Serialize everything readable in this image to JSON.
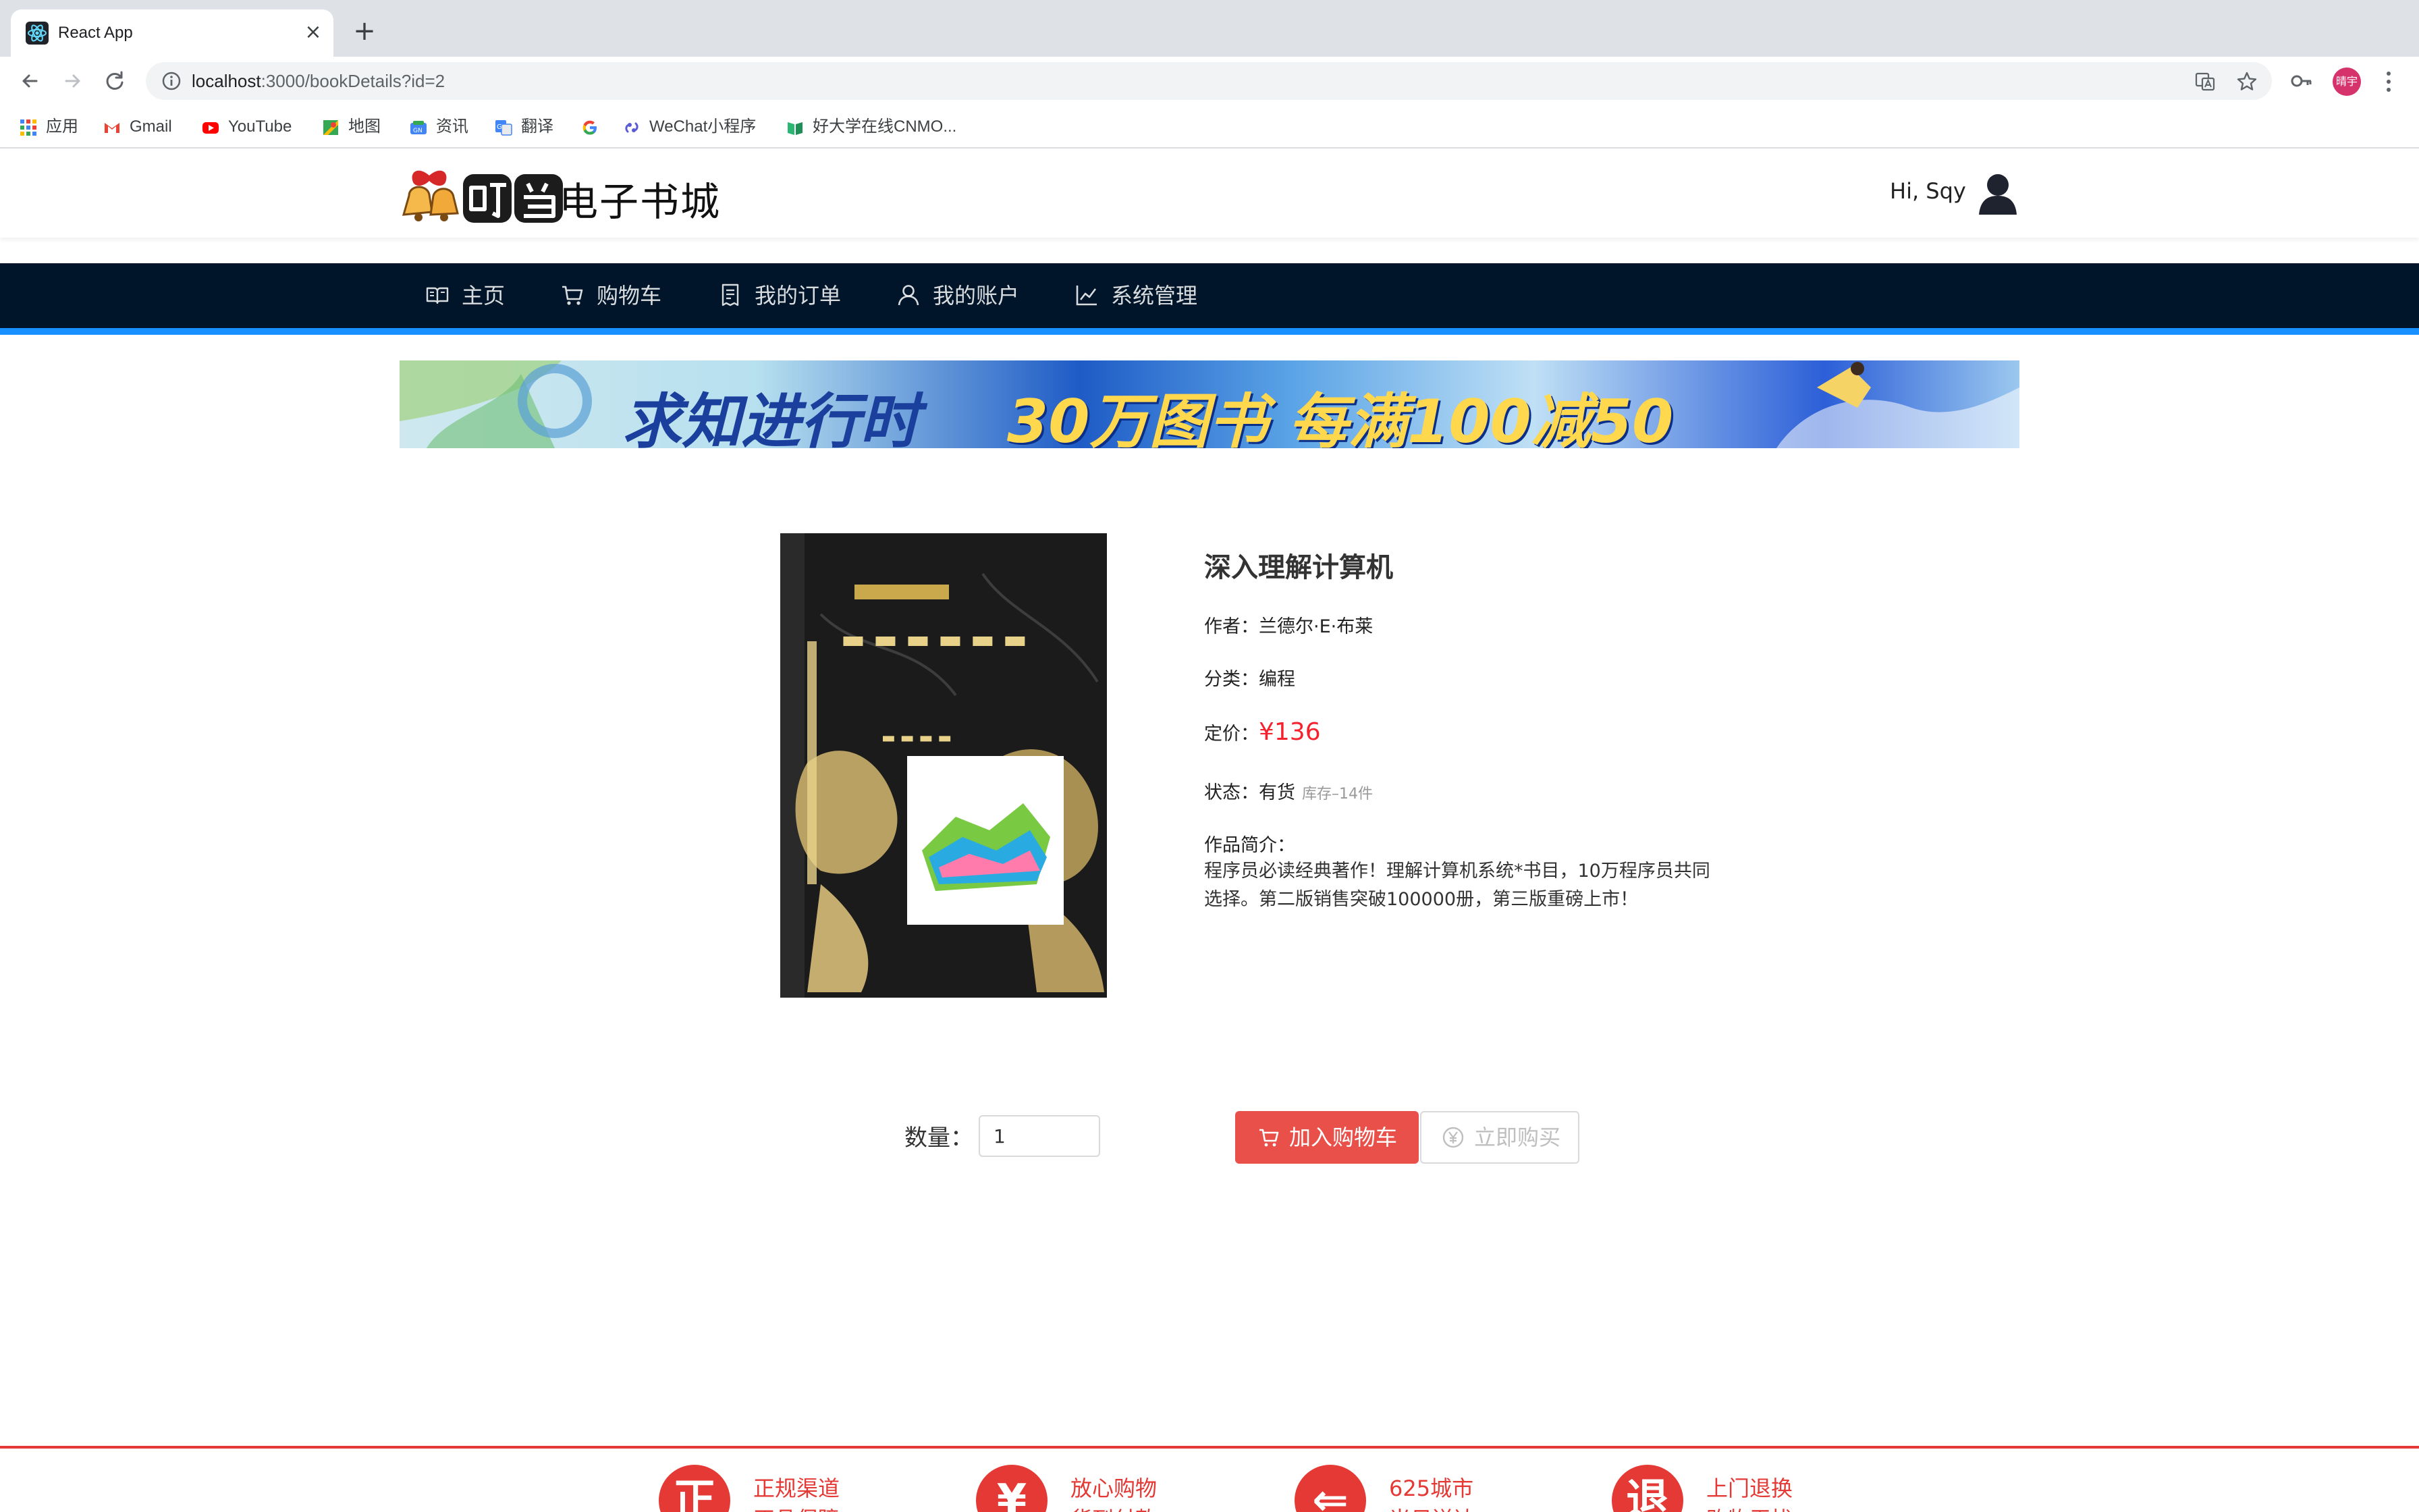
{
  "browser": {
    "tab_title": "React App",
    "tab_close": "×",
    "new_tab": "+",
    "url_host": "localhost",
    "url_path": ":3000/bookDetails?id=2",
    "profile_initials": "晴宇"
  },
  "bookmarks": [
    {
      "label": "应用",
      "icon": "apps-grid-icon"
    },
    {
      "label": "Gmail",
      "icon": "gmail-icon"
    },
    {
      "label": "YouTube",
      "icon": "youtube-icon"
    },
    {
      "label": "地图",
      "icon": "maps-icon"
    },
    {
      "label": "资讯",
      "icon": "news-icon"
    },
    {
      "label": "翻译",
      "icon": "translate-icon"
    },
    {
      "label": "",
      "icon": "google-icon"
    },
    {
      "label": "WeChat小程序",
      "icon": "wechat-link-icon"
    },
    {
      "label": "好大学在线CNMO...",
      "icon": "book-icon"
    }
  ],
  "header": {
    "logo_text": "电子书城",
    "greeting": "Hi, Sqy"
  },
  "nav": [
    {
      "label": "主页",
      "icon": "book-open-icon"
    },
    {
      "label": "购物车",
      "icon": "cart-icon"
    },
    {
      "label": "我的订单",
      "icon": "order-icon"
    },
    {
      "label": "我的账户",
      "icon": "user-icon"
    },
    {
      "label": "系统管理",
      "icon": "chart-line-icon"
    }
  ],
  "banner": {
    "text_left": "求知进行时",
    "text_right": "30万图书 每满100减50"
  },
  "book": {
    "title": "深入理解计算机",
    "author_label": "作者：",
    "author": "兰德尔·E·布莱",
    "category_label": "分类：",
    "category": "编程",
    "price_label": "定价：",
    "price": "¥136",
    "status_label": "状态：",
    "status": "有货",
    "stock": "库存–14件",
    "intro_label": "作品简介：",
    "intro": "程序员必读经典著作！理解计算机系统*书目，10万程序员共同选择。第二版销售突破100000册，第三版重磅上市！"
  },
  "purchase": {
    "qty_label": "数量：",
    "qty_value": "1",
    "add_to_cart": "加入购物车",
    "buy_now": "立即购买"
  },
  "footer": {
    "features": [
      {
        "icon_char": "正",
        "title": "正规渠道",
        "sub": "正品保障"
      },
      {
        "icon_char": "¥",
        "title": "放心购物",
        "sub": "货到付款"
      },
      {
        "icon_char": "⇐",
        "title": "625城市",
        "sub": "当日送达"
      },
      {
        "icon_char": "退",
        "title": "上门退换",
        "sub": "购物无忧"
      }
    ]
  },
  "colors": {
    "nav_bg": "#001529",
    "nav_accent": "#1890ff",
    "price": "#f5222d",
    "cart_button": "#e9504a",
    "footer_red": "#e53935"
  }
}
